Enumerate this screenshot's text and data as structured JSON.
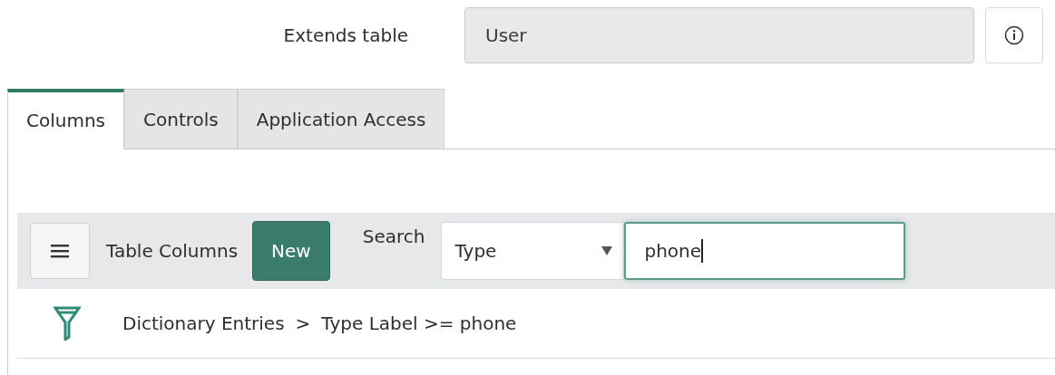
{
  "field": {
    "label": "Extends table",
    "value": "User"
  },
  "tabs": [
    {
      "label": "Columns",
      "selected": true
    },
    {
      "label": "Controls",
      "selected": false
    },
    {
      "label": "Application Access",
      "selected": false
    }
  ],
  "list": {
    "title": "Table Columns",
    "new_button": "New",
    "search_label": "Search",
    "search_field": "Type",
    "search_value": "phone"
  },
  "breadcrumb": [
    "Dictionary Entries",
    ">",
    "Type Label >= phone"
  ]
}
